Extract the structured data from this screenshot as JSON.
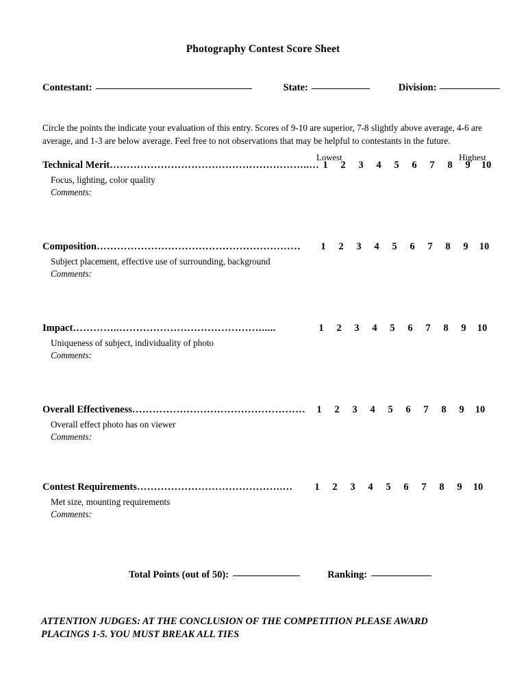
{
  "document": {
    "title": "Photography Contest Score Sheet"
  },
  "header": {
    "contestant_label": "Contestant:",
    "state_label": "State:",
    "division_label": "Division:",
    "contestant_value": "",
    "state_value": "",
    "division_value": ""
  },
  "instructions": {
    "text": "Circle the points the indicate your evaluation of this entry. Scores of 9-10 are superior, 7-8 slightly above average, 4-6 are average, and 1-3 are below average. Feel free to not observations that may be helpful to contestants in the future."
  },
  "scale_header": {
    "lowest_label": "Lowest",
    "highest_label": "Highest"
  },
  "scale": {
    "points": [
      "1",
      "2",
      "3",
      "4",
      "5",
      "6",
      "7",
      "8",
      "9",
      "10"
    ]
  },
  "comments_label": "Comments:",
  "criteria": [
    {
      "name": "Technical Merit",
      "dots": "…………………………………………………..…",
      "description": "Focus, lighting, color quality",
      "comments_value": ""
    },
    {
      "name": "Composition",
      "dots": "……………………………………………………",
      "description": "Subject placement, effective use of surrounding, background",
      "comments_value": ""
    },
    {
      "name": "Impact",
      "dots": "…………..…………………………………….....",
      "description": "Uniqueness of subject, individuality of photo",
      "comments_value": ""
    },
    {
      "name": "Overall Effectiveness",
      "dots": "……………………………………………",
      "description": "Overall effect photo has on viewer",
      "comments_value": ""
    },
    {
      "name": "Contest Requirements",
      "dots": "…………………………………….…",
      "description": "Met size, mounting requirements",
      "comments_value": ""
    }
  ],
  "totals": {
    "total_points_label": "Total Points (out of 50):",
    "total_points_value": "",
    "ranking_label": "Ranking:",
    "ranking_value": ""
  },
  "attention": {
    "line1": "ATTENTION JUDGES: AT THE CONCLUSION OF THE COMPETITION PLEASE AWARD",
    "line2": "PLACINGS 1-5. YOU MUST BREAK ALL TIES"
  }
}
